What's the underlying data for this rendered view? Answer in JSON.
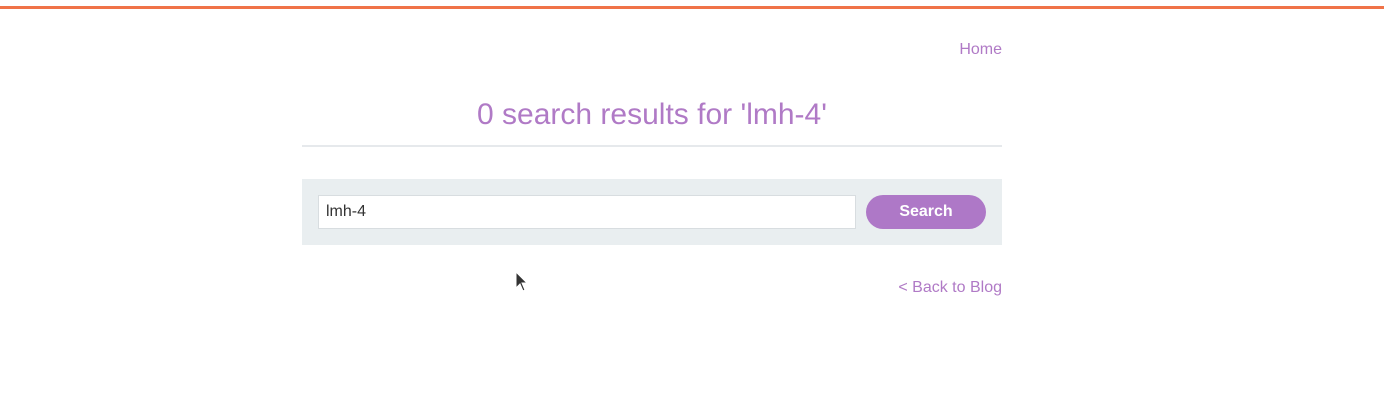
{
  "nav": {
    "home_label": "Home"
  },
  "results": {
    "title": "0 search results for 'lmh-4'"
  },
  "search": {
    "value": "lmh-4",
    "button_label": "Search"
  },
  "footer": {
    "back_label": "< Back to Blog"
  },
  "colors": {
    "accent": "#b07ac6",
    "top_bar": "#f07348",
    "panel_bg": "#e9eef0"
  }
}
